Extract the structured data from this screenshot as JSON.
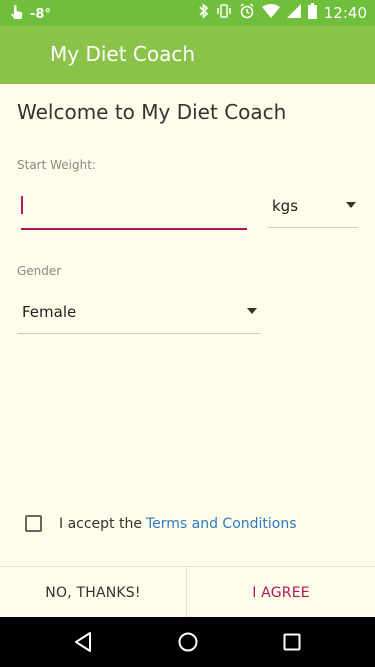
{
  "status_bar": {
    "temperature": "-8°",
    "time": "12:40",
    "icons": [
      "touch-icon",
      "bluetooth-icon",
      "vibrate-icon",
      "alarm-icon",
      "wifi-icon",
      "signal-icon",
      "battery-icon"
    ]
  },
  "app_bar": {
    "title": "My Diet Coach"
  },
  "form": {
    "welcome": "Welcome to My Diet Coach",
    "start_weight_label": "Start Weight:",
    "start_weight_value": "",
    "unit_value": "kgs",
    "gender_label": "Gender",
    "gender_value": "Female"
  },
  "terms": {
    "checked": false,
    "text": "I accept the",
    "link": "Terms and Conditions"
  },
  "footer": {
    "decline": "NO, THANKS!",
    "agree": "I AGREE"
  },
  "colors": {
    "status_bar": "#6fbf3c",
    "app_bar": "#8bc34a",
    "accent": "#b3145f",
    "link": "#2e7bc4",
    "background": "#fefde9"
  },
  "nav_bar": {
    "icons": [
      "back-icon",
      "home-icon",
      "recents-icon"
    ]
  }
}
